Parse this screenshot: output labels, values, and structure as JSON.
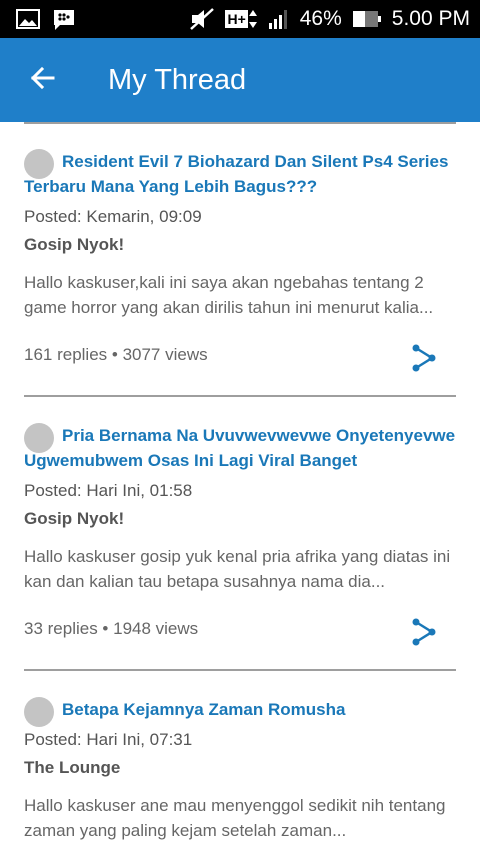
{
  "status_bar": {
    "battery_percent": "46%",
    "time": "5.00 PM",
    "network_label": "H+"
  },
  "app_bar": {
    "title": "My Thread"
  },
  "threads": [
    {
      "title": "Resident Evil 7 Biohazard Dan Silent Ps4 Series Terbaru Mana Yang Lebih Bagus???",
      "posted": "Posted: Kemarin, 09:09",
      "category": "Gosip Nyok!",
      "excerpt": "Hallo kaskuser,kali ini saya akan ngebahas tentang 2 game horror yang akan dirilis tahun ini menurut kalia...",
      "stats": "161 replies • 3077 views"
    },
    {
      "title": "Pria Bernama Na Uvuvwevwevwe Onyetenyevwe Ugwemubwem Osas Ini Lagi Viral Banget",
      "posted": "Posted: Hari Ini, 01:58",
      "category": "Gosip Nyok!",
      "excerpt": "Hallo kaskuser gosip yuk kenal pria afrika yang diatas ini kan dan kalian tau betapa susahnya nama dia...",
      "stats": "33 replies • 1948 views"
    },
    {
      "title": "Betapa Kejamnya Zaman Romusha",
      "posted": "Posted: Hari Ini, 07:31",
      "category": "The Lounge",
      "excerpt": "Hallo kaskuser ane mau menyenggol sedikit nih tentang zaman yang paling kejam setelah zaman...",
      "stats": ""
    }
  ],
  "colors": {
    "app_bar": "#1f7fc9",
    "title_link": "#1a78b8",
    "share_icon": "#1a78b8"
  }
}
